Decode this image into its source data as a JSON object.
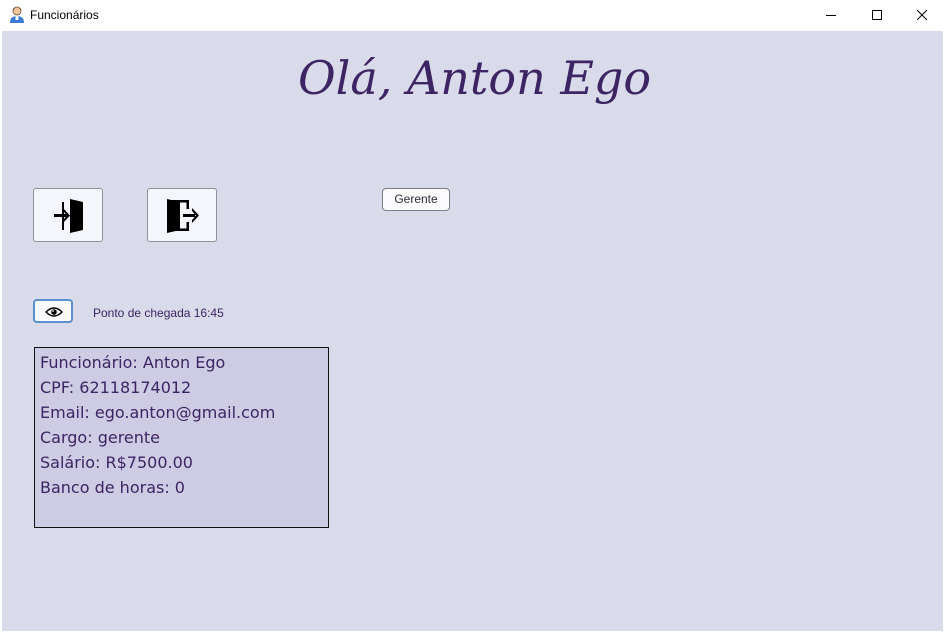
{
  "window": {
    "title": "Funcionários",
    "icon": "user-avatar-icon"
  },
  "main": {
    "greeting": "Olá, Anton Ego",
    "clock_in_icon": "enter-door-icon",
    "clock_out_icon": "exit-door-icon",
    "role_button_label": "Gerente",
    "toggle_icon": "eye-icon",
    "arrival_text": "Ponto de chegada 16:45"
  },
  "employee": {
    "name_line": "Funcionário: Anton Ego",
    "cpf_line": "CPF: 62118174012",
    "email_line": "Email: ego.anton@gmail.com",
    "role_line": "Cargo: gerente",
    "salary_line": "Salário: R$7500.00",
    "hours_line": "Banco de horas: 0"
  },
  "colors": {
    "background": "#d9dbea",
    "heading": "#3d2462",
    "info_box": "#cdcce4",
    "focus_border": "#5a8fd0"
  }
}
